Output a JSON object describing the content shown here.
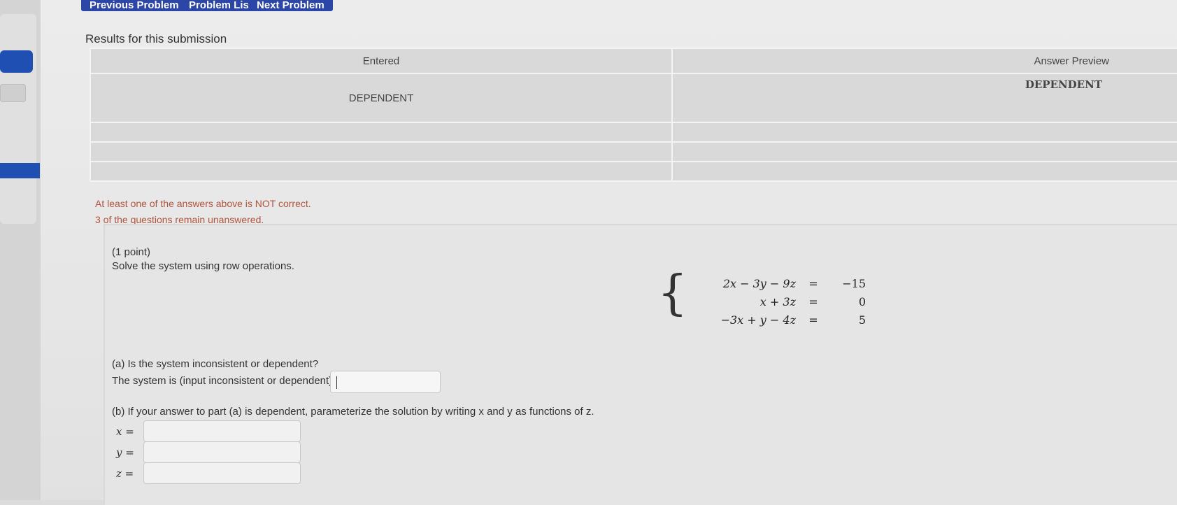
{
  "nav": {
    "previous": "Previous Problem",
    "list": "Problem List",
    "next": "Next Problem"
  },
  "results": {
    "title": "Results for this submission",
    "col_entered": "Entered",
    "col_preview": "Answer Preview",
    "rows": [
      {
        "entered": "DEPENDENT",
        "preview": "DEPENDENT"
      },
      {
        "entered": "",
        "preview": ""
      },
      {
        "entered": "",
        "preview": ""
      },
      {
        "entered": "",
        "preview": ""
      }
    ],
    "msg_incorrect": "At least one of the answers above is NOT correct.",
    "msg_unanswered": "3 of the questions remain unanswered."
  },
  "problem": {
    "points": "(1 point)",
    "instruction": "Solve the system using row operations.",
    "system": [
      {
        "lhs": "2x − 3y − 9z",
        "eq": "=",
        "rhs": "−15"
      },
      {
        "lhs": "x + 3z",
        "eq": "=",
        "rhs": "0"
      },
      {
        "lhs": "−3x + y − 4z",
        "eq": "=",
        "rhs": "5"
      }
    ],
    "part_a_question": "(a) Is the system inconsistent or dependent?",
    "part_a_prompt": "The system is (input inconsistent or dependent)",
    "part_a_value": "",
    "part_b_question": "(b) If your answer to part (a) is dependent, parameterize the solution by writing x and y as functions of z.",
    "vars": [
      {
        "label": "x =",
        "value": ""
      },
      {
        "label": "y =",
        "value": ""
      },
      {
        "label": "z =",
        "value": ""
      }
    ]
  }
}
